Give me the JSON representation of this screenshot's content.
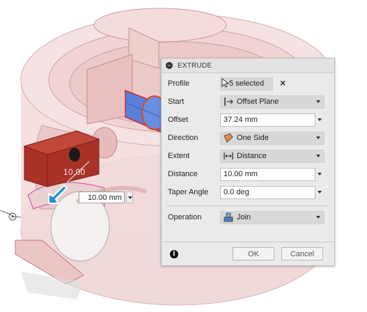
{
  "dialog": {
    "title": "EXTRUDE",
    "rows": {
      "profile": {
        "label": "Profile",
        "value": "5 selected",
        "icon": "cursor-select-icon"
      },
      "start": {
        "label": "Start",
        "value": "Offset Plane",
        "icon": "offset-plane-icon"
      },
      "offset": {
        "label": "Offset",
        "value": "37.24 mm"
      },
      "direction": {
        "label": "Direction",
        "value": "One Side",
        "icon": "one-side-icon"
      },
      "extent": {
        "label": "Extent",
        "value": "Distance",
        "icon": "distance-icon"
      },
      "distance": {
        "label": "Distance",
        "value": "10.00 mm"
      },
      "taper": {
        "label": "Taper Angle",
        "value": "0.0 deg"
      },
      "operation": {
        "label": "Operation",
        "value": "Join",
        "icon": "join-icon"
      }
    },
    "ok_label": "OK",
    "cancel_label": "Cancel"
  },
  "canvas": {
    "distance_input": "10.00 mm",
    "ghost_value": "10.00"
  },
  "colors": {
    "body_pink": "#f2d0d0",
    "extrude_red": "#b8392a",
    "profile_blue": "#5a7fd8",
    "arrow_blue": "#1f8fd6",
    "panel_bg": "#eaeaea"
  }
}
